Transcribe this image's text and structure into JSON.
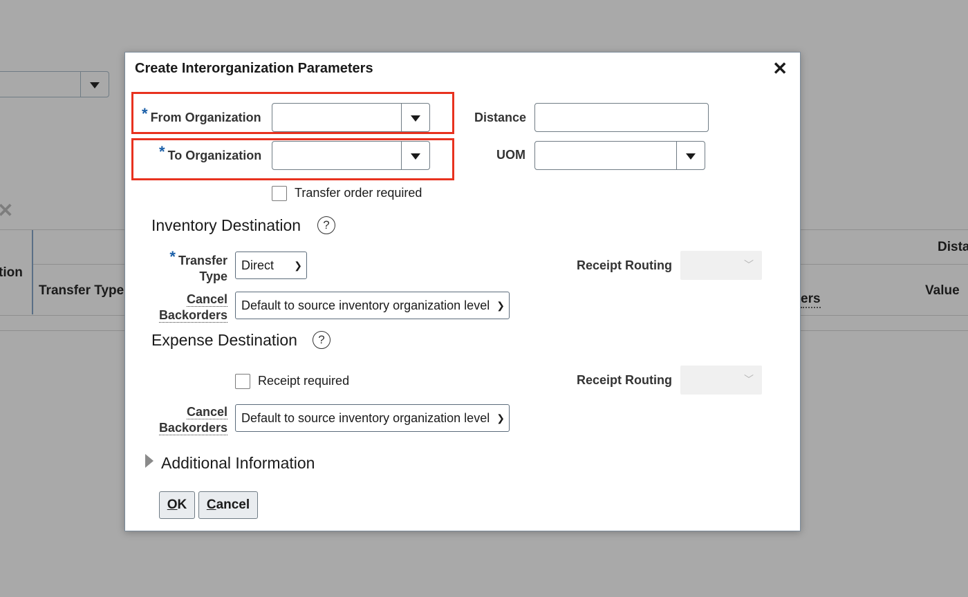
{
  "background": {
    "column_fragment_1": "tion",
    "column_transfer_type": "Transfer Type",
    "column_fragment_orders": "ers",
    "column_fragment_dist": "Dista",
    "column_value": "Value"
  },
  "dialog": {
    "title": "Create Interorganization Parameters",
    "close_icon": "close-icon",
    "from_org": {
      "label": "From Organization",
      "required": true,
      "value": ""
    },
    "to_org": {
      "label": "To Organization",
      "required": true,
      "value": ""
    },
    "distance": {
      "label": "Distance",
      "value": ""
    },
    "uom": {
      "label": "UOM",
      "value": ""
    },
    "transfer_order_required": {
      "label": "Transfer order required",
      "checked": false
    },
    "inventory_destination": {
      "title": "Inventory Destination",
      "transfer_type_label_1": "Transfer",
      "transfer_type_label_2": "Type",
      "transfer_type_value": "Direct",
      "receipt_routing_label": "Receipt Routing",
      "receipt_routing_value": "",
      "cancel_backorders_label_1": "Cancel",
      "cancel_backorders_label_2": "Backorders",
      "cancel_backorders_value": "Default to source inventory organization level"
    },
    "expense_destination": {
      "title": "Expense Destination",
      "receipt_required_label": "Receipt required",
      "receipt_routing_label": "Receipt Routing",
      "receipt_routing_value": "",
      "cancel_backorders_label_1": "Cancel",
      "cancel_backorders_label_2": "Backorders",
      "cancel_backorders_value": "Default to source inventory organization level"
    },
    "additional_information": "Additional Information",
    "ok_label_first": "O",
    "ok_label_rest": "K",
    "cancel_label_first": "C",
    "cancel_label_rest": "ancel",
    "help_glyph": "?",
    "required_glyph": "*"
  },
  "colors": {
    "overlay": "#a9a9a9",
    "highlight": "#e8321f",
    "required": "#1a5fa8"
  }
}
